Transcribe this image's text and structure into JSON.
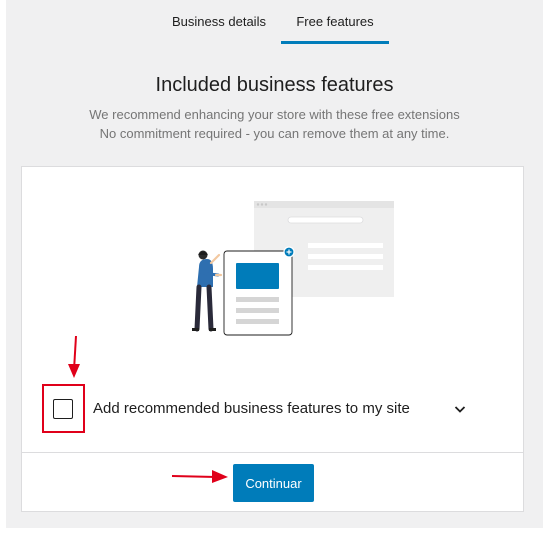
{
  "tabs": [
    {
      "label": "Business details",
      "active": false
    },
    {
      "label": "Free features",
      "active": true
    }
  ],
  "heading": "Included business features",
  "subtitle_line1": "We recommend enhancing your store with these free extensions",
  "subtitle_line2": "No commitment required - you can remove them at any time.",
  "option": {
    "label": "Add recommended business features to my site",
    "checked": false
  },
  "continue_button": "Continuar",
  "colors": {
    "accent": "#007cba",
    "annotation": "#e0001a",
    "background": "#f0f0f1"
  }
}
